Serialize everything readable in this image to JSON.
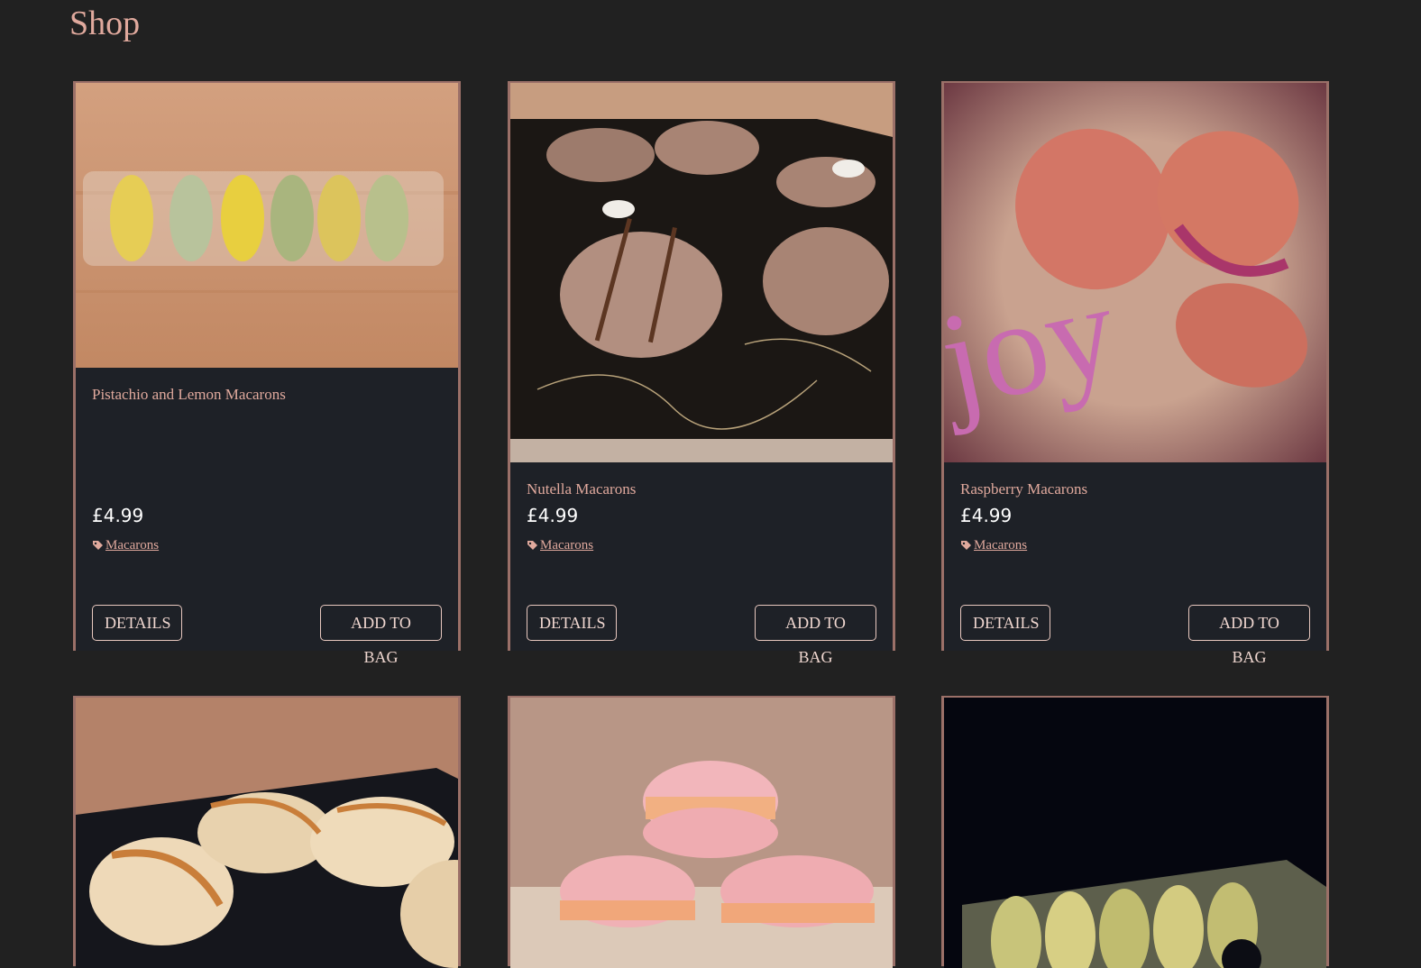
{
  "page": {
    "title": "Shop"
  },
  "products": [
    {
      "name": "Pistachio and Lemon Macarons",
      "price": "£4.99",
      "category": "Macarons",
      "details_label": "DETAILS",
      "add_label": "ADD TO BAG"
    },
    {
      "name": "Nutella Macarons",
      "price": "£4.99",
      "category": "Macarons",
      "details_label": "DETAILS",
      "add_label": "ADD TO BAG"
    },
    {
      "name": "Raspberry Macarons",
      "price": "£4.99",
      "category": "Macarons",
      "details_label": "DETAILS",
      "add_label": "ADD TO BAG"
    }
  ],
  "icons": {
    "category": "tag-icon"
  },
  "colors": {
    "background": "#212121",
    "card": "#1e2127",
    "accent": "#e0a99d",
    "border": "#9b7068"
  }
}
